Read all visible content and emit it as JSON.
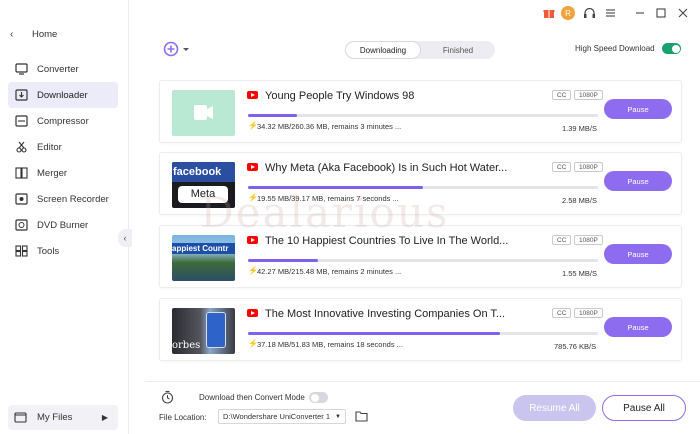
{
  "sidebar": {
    "home_label": "Home",
    "items": [
      {
        "label": "Converter",
        "icon": "converter-icon"
      },
      {
        "label": "Downloader",
        "icon": "downloader-icon"
      },
      {
        "label": "Compressor",
        "icon": "compressor-icon"
      },
      {
        "label": "Editor",
        "icon": "editor-icon"
      },
      {
        "label": "Merger",
        "icon": "merger-icon"
      },
      {
        "label": "Screen Recorder",
        "icon": "screen-recorder-icon"
      },
      {
        "label": "DVD Burner",
        "icon": "dvd-icon"
      },
      {
        "label": "Tools",
        "icon": "tools-icon"
      }
    ],
    "active_index": 1,
    "my_files_label": "My Files"
  },
  "header": {
    "tabs": [
      {
        "label": "Downloading",
        "active": true
      },
      {
        "label": "Finished",
        "active": false
      }
    ],
    "high_speed_label": "High Speed Download",
    "high_speed_on": true,
    "avatar_initial": "R"
  },
  "downloads": [
    {
      "title": "Young People Try Windows 98",
      "badges": [
        "CC",
        "1080P"
      ],
      "progress": 0.14,
      "stats": "34.32 MB/260.36 MB, remains 3 minutes ...",
      "speed": "1.39 MB/S",
      "action": "Pause"
    },
    {
      "title": "Why Meta (Aka Facebook) Is in Such Hot Water...",
      "badges": [
        "CC",
        "1080P"
      ],
      "progress": 0.5,
      "stats": "19.55 MB/39.17 MB, remains 7 seconds ...",
      "speed": "2.58 MB/S",
      "action": "Pause"
    },
    {
      "title": "The 10 Happiest Countries To Live In The World...",
      "badges": [
        "CC",
        "1080P"
      ],
      "progress": 0.2,
      "stats": "42.27 MB/215.48 MB, remains 2 minutes ...",
      "speed": "1.55 MB/S",
      "action": "Pause"
    },
    {
      "title": "The Most Innovative Investing Companies On T...",
      "badges": [
        "CC",
        "1080P"
      ],
      "progress": 0.72,
      "stats": "37.18 MB/51.83 MB, remains 18 seconds ...",
      "speed": "785.76 KB/S",
      "action": "Pause"
    }
  ],
  "thumb_texts": {
    "facebook": "facebook",
    "meta": "Meta",
    "happiest": "appiest Countr",
    "forbes": "orbes"
  },
  "bottom": {
    "convert_mode_label": "Download then Convert Mode",
    "convert_mode_on": false,
    "file_location_label": "File Location:",
    "file_location_value": "D:\\Wondershare UniConverter 1",
    "resume_all": "Resume All",
    "pause_all": "Pause All"
  },
  "colors": {
    "accent": "#8e6cf0",
    "progress": "#7b60f2",
    "toggle_on": "#1aa06d",
    "youtube": "#ff0000",
    "avatar": "#f2a33a"
  },
  "watermark": "Dealarious"
}
